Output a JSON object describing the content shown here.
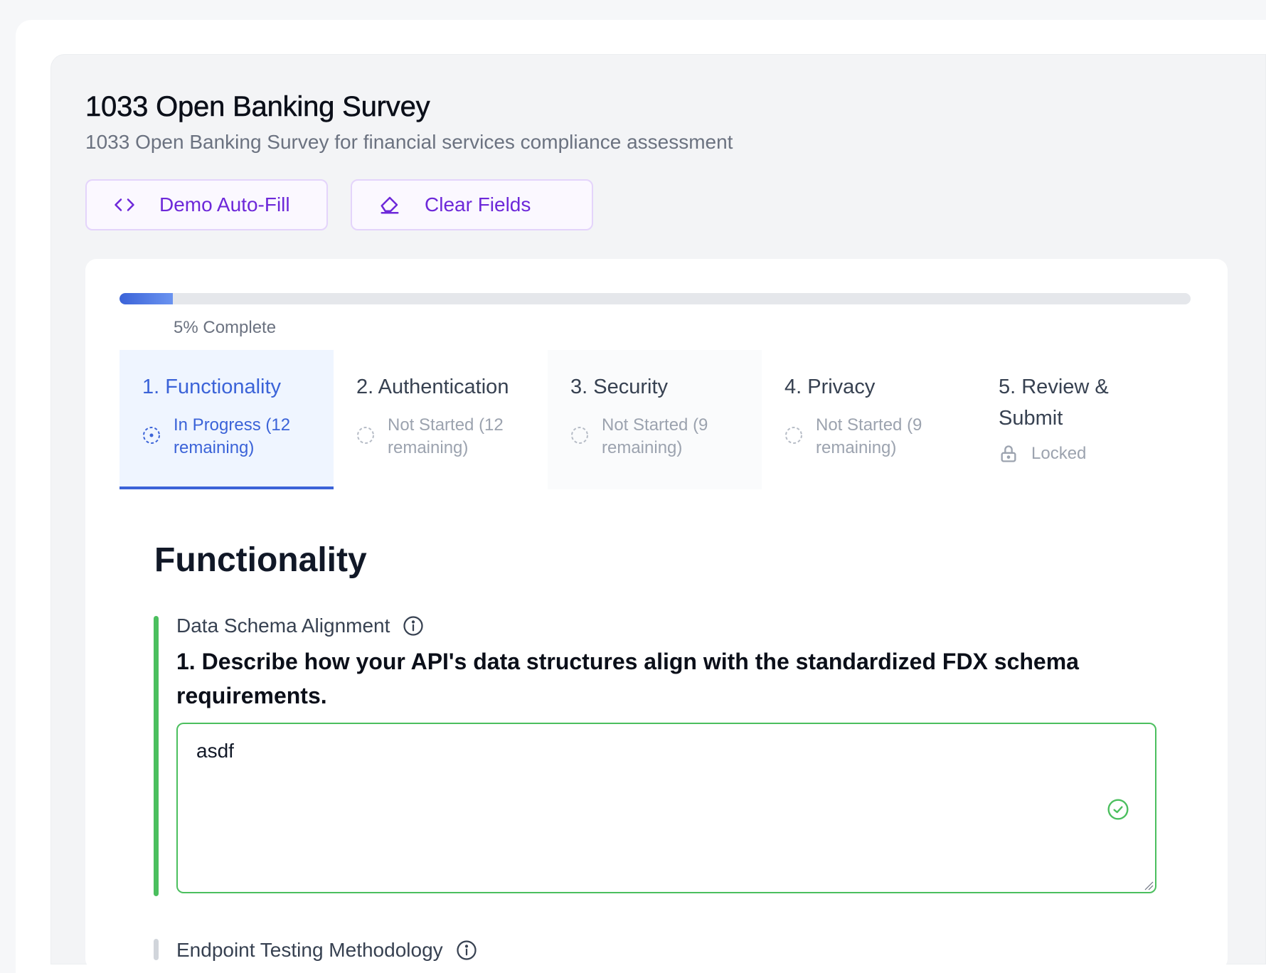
{
  "header": {
    "title": "1033 Open Banking Survey",
    "subtitle": "1033 Open Banking Survey for financial services compliance assessment"
  },
  "actions": {
    "demo_label": "Demo Auto-Fill",
    "demo_icon": "code-brackets-icon",
    "clear_label": "Clear Fields",
    "clear_icon": "eraser-icon"
  },
  "progress": {
    "percent": 5,
    "label": "5% Complete"
  },
  "steps": [
    {
      "title": "1. Functionality",
      "status": "In Progress (12 remaining)",
      "state": "active"
    },
    {
      "title": "2. Authentication",
      "status": "Not Started (12 remaining)",
      "state": "not-started"
    },
    {
      "title": "3. Security",
      "status": "Not Started (9 remaining)",
      "state": "not-started"
    },
    {
      "title": "4. Privacy",
      "status": "Not Started (9 remaining)",
      "state": "not-started"
    },
    {
      "title": "5. Review & Submit",
      "status": "Locked",
      "state": "locked"
    }
  ],
  "section": {
    "title": "Functionality",
    "questions": [
      {
        "label": "Data Schema Alignment",
        "text": "1. Describe how your API's data structures align with the standardized FDX schema requirements.",
        "answer": "asdf"
      },
      {
        "label": "Endpoint Testing Methodology"
      }
    ]
  },
  "colors": {
    "accent": "#3b63d8",
    "purple": "#6d28d9",
    "success": "#4bbf5e"
  }
}
